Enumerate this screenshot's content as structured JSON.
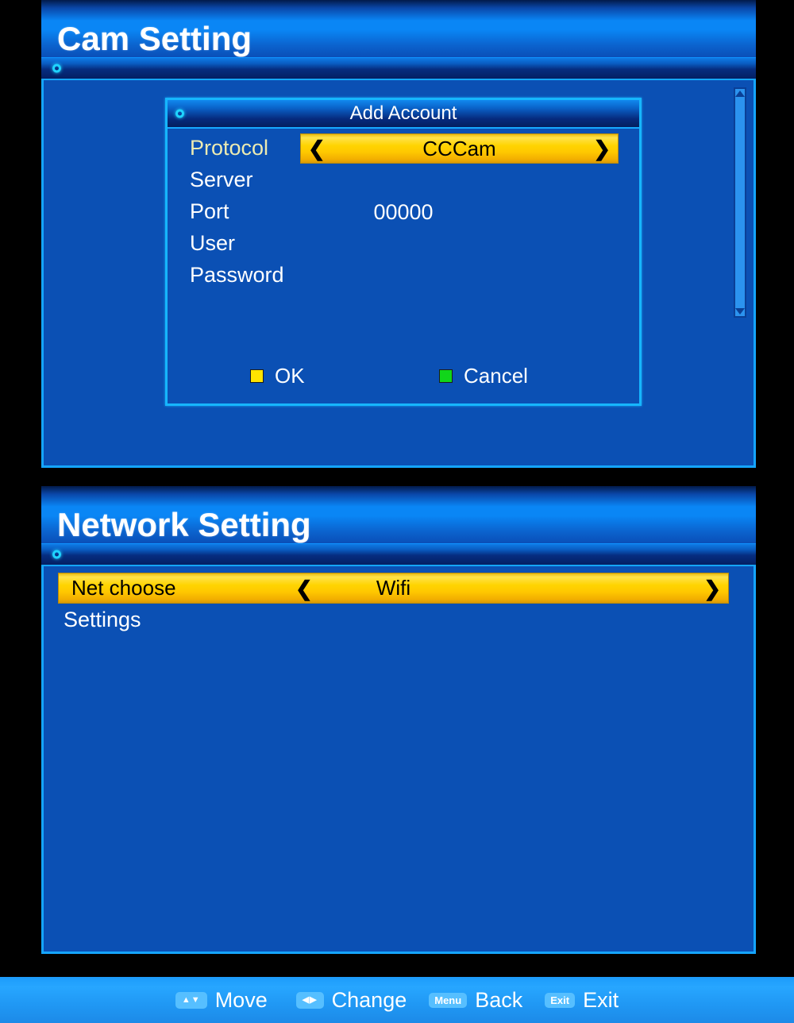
{
  "screens": [
    {
      "title": "Cam Setting",
      "dialog": {
        "title": "Add Account",
        "rows": [
          {
            "label": "Protocol",
            "value": "CCCam",
            "type": "selector",
            "selected": true
          },
          {
            "label": "Server",
            "value": "",
            "type": "text",
            "selected": false
          },
          {
            "label": "Port",
            "value": "00000",
            "type": "text",
            "selected": false
          },
          {
            "label": "User",
            "value": "",
            "type": "text",
            "selected": false
          },
          {
            "label": "Password",
            "value": "",
            "type": "text",
            "selected": false
          }
        ],
        "buttons": [
          {
            "label": "OK",
            "key_color": "#ffe400"
          },
          {
            "label": "Cancel",
            "key_color": "#11d61a"
          }
        ],
        "chevron_left": "❮",
        "chevron_right": "❯"
      },
      "scrollbar": {
        "up_icon": "triangle-up",
        "down_icon": "triangle-down"
      }
    },
    {
      "title": "Network Setting",
      "rows": [
        {
          "label": "Net choose",
          "value": "Wifi",
          "type": "selector",
          "selected": true
        },
        {
          "label": "Settings",
          "value": "",
          "type": "plain",
          "selected": false
        }
      ],
      "chevron_left": "❮",
      "chevron_right": "❯"
    }
  ],
  "statusbar": {
    "hints": [
      {
        "badge": "▲▼",
        "badge_kind": "arrows",
        "label": "Move"
      },
      {
        "badge": "◀▶",
        "badge_kind": "arrows",
        "label": "Change"
      },
      {
        "badge": "Menu",
        "badge_kind": "text",
        "label": "Back"
      },
      {
        "badge": "Exit",
        "badge_kind": "text",
        "label": "Exit"
      }
    ]
  },
  "colors": {
    "panel_blue": "#0b50b4",
    "accent_cyan": "#15a5ff",
    "highlight_yellow": "#ffd400",
    "statusbar_blue": "#27a6ff"
  }
}
